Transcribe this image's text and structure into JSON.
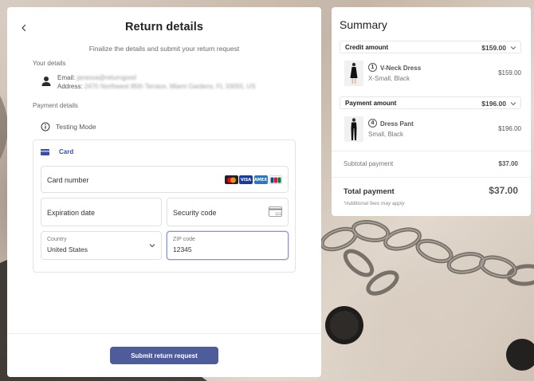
{
  "return_form": {
    "title": "Return details",
    "subtitle": "Finalize the details and submit your return request",
    "your_details_label": "Your details",
    "email_prefix": "Email:",
    "email_value": "janessa@returngood",
    "address_prefix": "Address:",
    "address_value": "2470 Northwest 85th Terrace, Miami Gardens, FL 33055, US",
    "payment_details_label": "Payment details",
    "testing_mode_label": "Testing Mode",
    "card_tab_label": "Card",
    "card_number_label": "Card number",
    "card_brands": [
      "mastercard",
      "visa",
      "amex",
      "jcb"
    ],
    "expiration_label": "Expiration date",
    "security_code_label": "Security code",
    "country_label": "Country",
    "country_value": "United States",
    "zip_label": "ZIP code",
    "zip_value": "12345",
    "submit_label": "Submit return request"
  },
  "summary": {
    "title": "Summary",
    "credit_amount_label": "Credit amount",
    "credit_amount_value": "$159.00",
    "payment_amount_label": "Payment amount",
    "payment_amount_value": "$196.00",
    "items": [
      {
        "qty": "1",
        "name": "V-Neck Dress",
        "variant": "X-Small, Black",
        "price": "$159.00"
      },
      {
        "qty": "4",
        "name": "Dress Pant",
        "variant": "Small, Black",
        "price": "$196.00"
      }
    ],
    "subtotal_label": "Subtotal payment",
    "subtotal_value": "$37.00",
    "total_label": "Total payment",
    "total_value": "$37.00",
    "fees_note": "*Additional fees may apply"
  },
  "colors": {
    "accent": "#4f5c9c",
    "card_tab": "#3b4ea0",
    "zip_focus_border": "#8c96c7"
  }
}
